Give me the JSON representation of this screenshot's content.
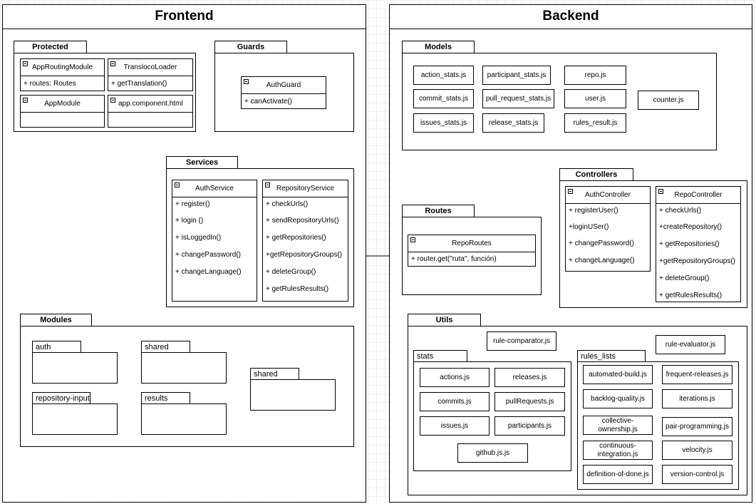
{
  "frontend": {
    "title": "Frontend",
    "protected": {
      "label": "Protected",
      "app_routing_module": {
        "name": "AppRoutingModule",
        "members": [
          "+ routes: Routes"
        ]
      },
      "transloco_loader": {
        "name": "TranslocoLoader",
        "members": [
          "+ getTranslation()"
        ]
      },
      "app_module": {
        "name": "AppModule"
      },
      "app_component": {
        "name": "app.component.html"
      }
    },
    "guards": {
      "label": "Guards",
      "auth_guard": {
        "name": "AuthGuard",
        "members": [
          "+ canActivate()"
        ]
      }
    },
    "services": {
      "label": "Services",
      "auth_service": {
        "name": "AuthService",
        "members": [
          "+ register()",
          "+ login ()",
          "+ isLoggedIn()",
          "+ changePassword()",
          "+ changeLanguage()"
        ]
      },
      "repository_service": {
        "name": "RepositoryService",
        "members": [
          "+ checkUrls()",
          "+ sendRepositoryUrls()",
          "+ getRepositories()",
          "+getRepositoryGroups()",
          "+ deleteGroup()",
          "+ getRulesResults()"
        ]
      }
    },
    "modules": {
      "label": "Modules",
      "items": [
        "auth",
        "shared",
        "repository-input",
        "results",
        "shared"
      ]
    }
  },
  "backend": {
    "title": "Backend",
    "models": {
      "label": "Models",
      "files": [
        "action_stats.js",
        "participant_stats.js",
        "repo.js",
        "commit_stats.js",
        "pull_request_stats.js",
        "user.js",
        "counter.js",
        "issues_stats.js",
        "release_stats.js",
        "rules_result.js"
      ]
    },
    "routes": {
      "label": "Routes",
      "repo_routes": {
        "name": "RepoRoutes",
        "members": [
          "+ router.get(\"ruta\", función)"
        ]
      }
    },
    "controllers": {
      "label": "Controllers",
      "auth_controller": {
        "name": "AuthController",
        "members": [
          "+ registerUser()",
          "+loginUSer()",
          "+ changePassword()",
          "+ changeLanguage()"
        ]
      },
      "repo_controller": {
        "name": "RepoController",
        "members": [
          "+ checkUrls()",
          "+createRepository()",
          "+ getRepositories()",
          "+getRepositoryGroups()",
          "+ deleteGroup()",
          "+ getRulesResults()"
        ]
      }
    },
    "utils": {
      "label": "Utils",
      "rule_comparator": "rule-comparator.js",
      "rule_evaluator": "rule-evaluator.js",
      "stats": {
        "label": "stats",
        "files": [
          "actions.js",
          "releases.js",
          "commits.js",
          "pullRequests.js",
          "issues.js",
          "participants.js",
          "github.js.js"
        ]
      },
      "rules_lists": {
        "label": "rules_lists",
        "files": [
          "automated-build.js",
          "frequent-releases.js",
          "backlog-quality.js",
          "iterations.js",
          "collective-ownership.js",
          "pair-programming.js",
          "continuous-integration.js",
          "velocity.js",
          "definition-of-done.js",
          "version-control.js"
        ]
      }
    }
  }
}
